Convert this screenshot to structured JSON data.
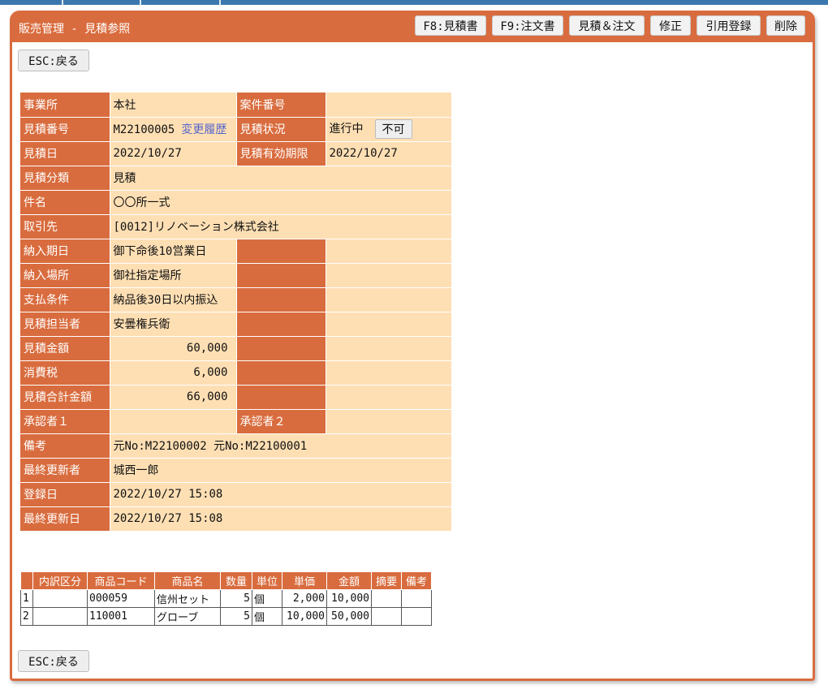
{
  "panel": {
    "title": "販売管理 - 見積参照",
    "buttons": [
      "F8:見積書",
      "F9:注文書",
      "見積＆注文",
      "修正",
      "引用登録",
      "削除"
    ]
  },
  "esc_label": "ESC:戻る",
  "info": {
    "office_label": "事業所",
    "office": "本社",
    "case_label": "案件番号",
    "case": "",
    "quote_no_label": "見積番号",
    "quote_no": "M22100005",
    "history_link": "変更履歴",
    "status_label": "見積状況",
    "status": "進行中",
    "status_button": "不可",
    "date_label": "見積日",
    "date": "2022/10/27",
    "valid_label": "見積有効期限",
    "valid": "2022/10/27",
    "class_label": "見積分類",
    "class": "見積",
    "subject_label": "件名",
    "subject": "〇〇所一式",
    "client_label": "取引先",
    "client": "[0012]リノベーション株式会社",
    "delivery_label": "納入期日",
    "delivery": "御下命後10営業日",
    "place_label": "納入場所",
    "place": "御社指定場所",
    "payment_label": "支払条件",
    "payment": "納品後30日以内振込",
    "staff_label": "見積担当者",
    "staff": "安曇権兵衛",
    "amount_label": "見積金額",
    "amount": "60,000",
    "tax_label": "消費税",
    "tax": "6,000",
    "total_label": "見積合計金額",
    "total": "66,000",
    "approver1_label": "承認者１",
    "approver1": "",
    "approver2_label": "承認者２",
    "approver2": "",
    "remarks_label": "備考",
    "remarks": "元No:M22100002 元No:M22100001",
    "updater_label": "最終更新者",
    "updater": "城西一郎",
    "registered_label": "登録日",
    "registered": "2022/10/27 15:08",
    "updated_label": "最終更新日",
    "updated": "2022/10/27 15:08"
  },
  "items": {
    "headers": [
      "",
      "内訳区分",
      "商品コード",
      "商品名",
      "数量",
      "単位",
      "単価",
      "金額",
      "摘要",
      "備考"
    ],
    "rows": [
      [
        "1",
        "",
        "000059",
        "信州セット",
        "5",
        "個",
        "2,000",
        "10,000",
        "",
        ""
      ],
      [
        "2",
        "",
        "110001",
        "グローブ",
        "5",
        "個",
        "10,000",
        "50,000",
        "",
        ""
      ]
    ]
  }
}
